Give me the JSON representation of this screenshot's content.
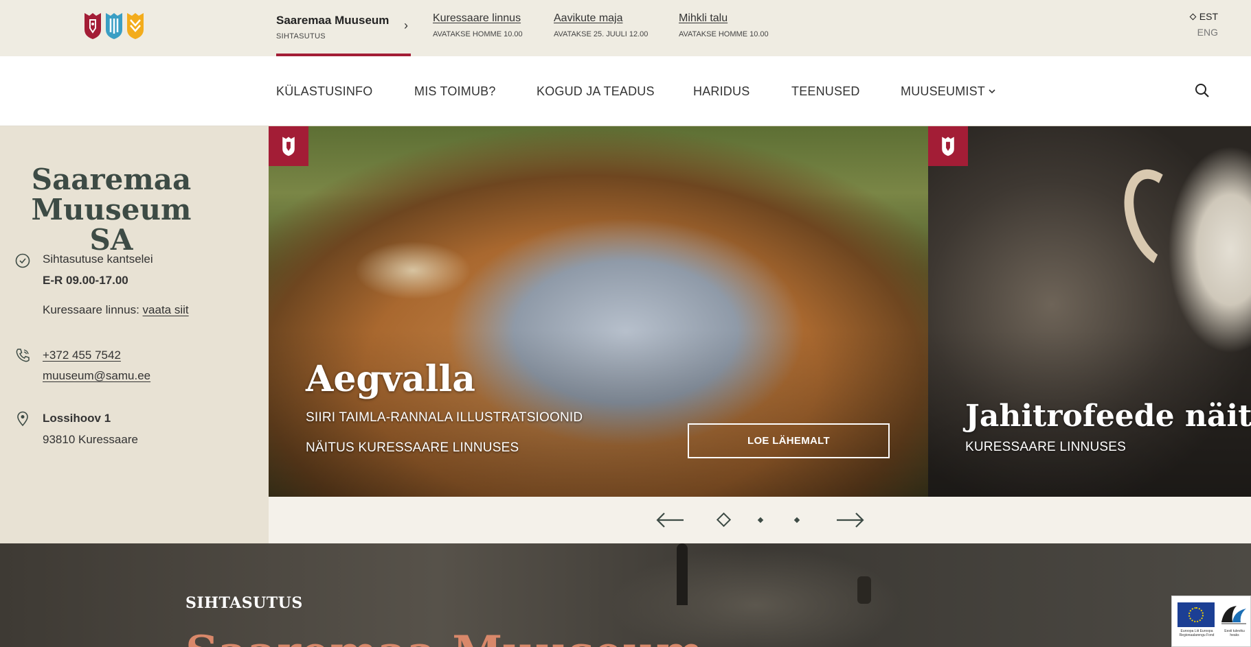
{
  "colors": {
    "brand_red": "#a31d36",
    "brand_blue": "#3a9ec4",
    "brand_yellow": "#f3ac1c",
    "dark_green": "#3d4b45",
    "cream": "#efece2",
    "panel": "#e8e2d4",
    "accent_salmon": "#d9886a"
  },
  "header": {
    "logo_icons": [
      "red-shield-icon",
      "blue-shield-icon",
      "yellow-shield-icon"
    ],
    "current_museum": {
      "name": "Saaremaa Muuseum",
      "sub": "SIHTASUTUS"
    },
    "museums": [
      {
        "name": "Kuressaare linnus",
        "status": "AVATAKSE HOMME 10.00"
      },
      {
        "name": "Aavikute maja",
        "status": "AVATAKSE 25. JUULI 12.00"
      },
      {
        "name": "Mihkli talu",
        "status": "AVATAKSE HOMME 10.00"
      }
    ],
    "languages": {
      "active": "EST",
      "other": "ENG"
    }
  },
  "nav": {
    "items": [
      "KÜLASTUSINFO",
      "MIS TOIMUB?",
      "KOGUD JA TEADUS",
      "HARIDUS",
      "TEENUSED",
      "MUUSEUMIST"
    ],
    "search_icon": "search-icon"
  },
  "info": {
    "title": "Saaremaa Muuseum SA",
    "office_label": "Sihtasutuse kantselei",
    "office_hours": "E-R 09.00-17.00",
    "castle_prefix": "Kuressaare linnus:",
    "castle_link": "vaata siit",
    "phone": "+372 455 7542",
    "email": "muuseum@samu.ee",
    "street": "Lossihoov 1",
    "city": "93810 Kuressaare"
  },
  "slides": [
    {
      "title": "Aegvalla",
      "subtitle": "SIIRI TAIMLA-RANNALA ILLUSTRATSIOONID",
      "location": "NÄITUS KURESSAARE LINNUSES",
      "button": "LOE LÄHEMALT"
    },
    {
      "title": "Jahitrofeede näitus",
      "location": "KURESSAARE LINNUSES"
    }
  ],
  "slider": {
    "slide_count": 3,
    "active_index": 0
  },
  "bottom": {
    "kicker": "SIHTASUTUS",
    "heading_partial": "Saaremaa Muuseum"
  }
}
